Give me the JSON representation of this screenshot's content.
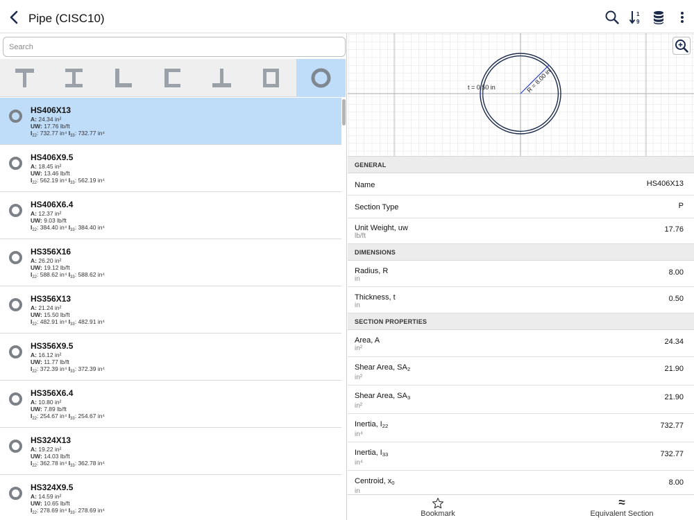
{
  "header": {
    "title": "Pipe (CISC10)"
  },
  "search": {
    "placeholder": "Search"
  },
  "sections": [
    {
      "name": "HS406X13",
      "a": "24.34 in²",
      "uw": "17.76 lb/ft",
      "i22": "732.77 in⁴",
      "i33": "732.77 in⁴"
    },
    {
      "name": "HS406X9.5",
      "a": "18.45 in²",
      "uw": "13.46 lb/ft",
      "i22": "562.19 in⁴",
      "i33": "562.19 in⁴"
    },
    {
      "name": "HS406X6.4",
      "a": "12.37 in²",
      "uw": "9.03 lb/ft",
      "i22": "384.40 in⁴",
      "i33": "384.40 in⁴"
    },
    {
      "name": "HS356X16",
      "a": "26.20 in²",
      "uw": "19.12 lb/ft",
      "i22": "588.62 in⁴",
      "i33": "588.62 in⁴"
    },
    {
      "name": "HS356X13",
      "a": "21.24 in²",
      "uw": "15.50 lb/ft",
      "i22": "482.91 in⁴",
      "i33": "482.91 in⁴"
    },
    {
      "name": "HS356X9.5",
      "a": "16.12 in²",
      "uw": "11.77 lb/ft",
      "i22": "372.39 in⁴",
      "i33": "372.39 in⁴"
    },
    {
      "name": "HS356X6.4",
      "a": "10.80 in²",
      "uw": "7.89 lb/ft",
      "i22": "254.67 in⁴",
      "i33": "254.67 in⁴"
    },
    {
      "name": "HS324X13",
      "a": "19.22 in²",
      "uw": "14.03 lb/ft",
      "i22": "362.78 in⁴",
      "i33": "362.78 in⁴"
    },
    {
      "name": "HS324X9.5",
      "a": "14.59 in²",
      "uw": "10.65 lb/ft",
      "i22": "278.69 in⁴",
      "i33": "278.69 in⁴"
    }
  ],
  "row_labels": {
    "a": "A:",
    "uw": "UW:",
    "i_symbol": "I",
    "i22_sub": "22",
    "i33_sub": "33"
  },
  "drawing": {
    "t_label": "t = 0.50 in",
    "r_label": "R = 8.00 in"
  },
  "general": {
    "header": "GENERAL",
    "name_label": "Name",
    "name_value": "HS406X13",
    "type_label": "Section Type",
    "type_value": "P",
    "uw_label": "Unit Weight, uw",
    "uw_unit": "lb/ft",
    "uw_value": "17.76"
  },
  "dimensions": {
    "header": "DIMENSIONS",
    "radius_label": "Radius, R",
    "radius_unit": "in",
    "radius_value": "8.00",
    "thick_label": "Thickness, t",
    "thick_unit": "in",
    "thick_value": "0.50"
  },
  "section_properties": {
    "header": "SECTION PROPERTIES",
    "area_label": "Area, A",
    "area_unit": "in²",
    "area_value": "24.34",
    "sa_label": "Shear Area, SA",
    "sa2_sub": "2",
    "sa2_unit": "in²",
    "sa2_value": "21.90",
    "sa3_sub": "3",
    "sa3_unit": "in²",
    "sa3_value": "21.90",
    "inertia_label": "Inertia, I",
    "i22_sub": "22",
    "i22_unit": "in⁴",
    "i22_value": "732.77",
    "i33_sub": "33",
    "i33_unit": "in⁴",
    "i33_value": "732.77",
    "centroid_label": "Centroid, x",
    "centroid_sub": "0",
    "centroid_unit": "in",
    "centroid_value": "8.00"
  },
  "bottom": {
    "bookmark": "Bookmark",
    "equivalent": "Equivalent Section",
    "approx_symbol": "≈"
  },
  "icons": {
    "back": "chevron-left-icon",
    "search": "magnifier-icon",
    "sort": "sort-numeric-icon",
    "database": "database-icon",
    "more": "more-vertical-icon",
    "zoom": "zoom-in-icon",
    "bookmark": "star-outline-icon"
  },
  "colors": {
    "accent": "#bfdcf8",
    "navy": "#1b2a4a",
    "shape_gray": "#9aa1a8"
  }
}
